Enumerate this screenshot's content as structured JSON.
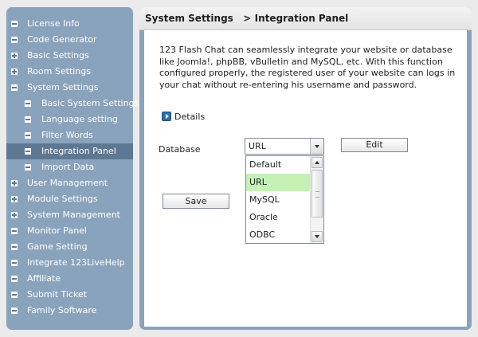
{
  "sidebar": {
    "items": [
      {
        "label": "License Info",
        "icon": "minus-icon"
      },
      {
        "label": "Code Generator",
        "icon": "minus-icon"
      },
      {
        "label": "Basic Settings",
        "icon": "plus-icon"
      },
      {
        "label": "Room Settings",
        "icon": "plus-icon"
      },
      {
        "label": "System Settings",
        "icon": "minus-icon"
      },
      {
        "label": "Basic System Settings",
        "icon": "minus-icon"
      },
      {
        "label": "Language setting",
        "icon": "minus-icon"
      },
      {
        "label": "Filter Words",
        "icon": "minus-icon"
      },
      {
        "label": "Integration Panel",
        "icon": "minus-icon"
      },
      {
        "label": "Import Data",
        "icon": "minus-icon"
      },
      {
        "label": "User Management",
        "icon": "plus-icon"
      },
      {
        "label": "Module Settings",
        "icon": "plus-icon"
      },
      {
        "label": "System Management",
        "icon": "plus-icon"
      },
      {
        "label": "Monitor Panel",
        "icon": "minus-icon"
      },
      {
        "label": "Game Setting",
        "icon": "minus-icon"
      },
      {
        "label": "Integrate 123LiveHelp",
        "icon": "minus-icon"
      },
      {
        "label": "Affiliate",
        "icon": "minus-icon"
      },
      {
        "label": "Submit Ticket",
        "icon": "minus-icon"
      },
      {
        "label": "Family Software",
        "icon": "minus-icon"
      }
    ]
  },
  "header": {
    "section": "System Settings",
    "separator": ">",
    "page": "Integration Panel"
  },
  "content": {
    "description": "123 Flash Chat can seamlessly integrate your website or database like Joomla!, phpBB, vBulletin and MySQL, etc. With this function configured properly, the registered user of your website can logs in your chat without re-entering his username and password.",
    "details_label": "Details",
    "database_label": "Database",
    "database_value": "URL",
    "edit_label": "Edit",
    "save_label": "Save",
    "database_options": [
      "Default",
      "URL",
      "MySQL",
      "Oracle",
      "ODBC"
    ],
    "selected_option": "URL"
  },
  "colors": {
    "panel": "#8aa3bc",
    "active_item": "#5e7792",
    "selected_option": "#c3f2b4"
  }
}
